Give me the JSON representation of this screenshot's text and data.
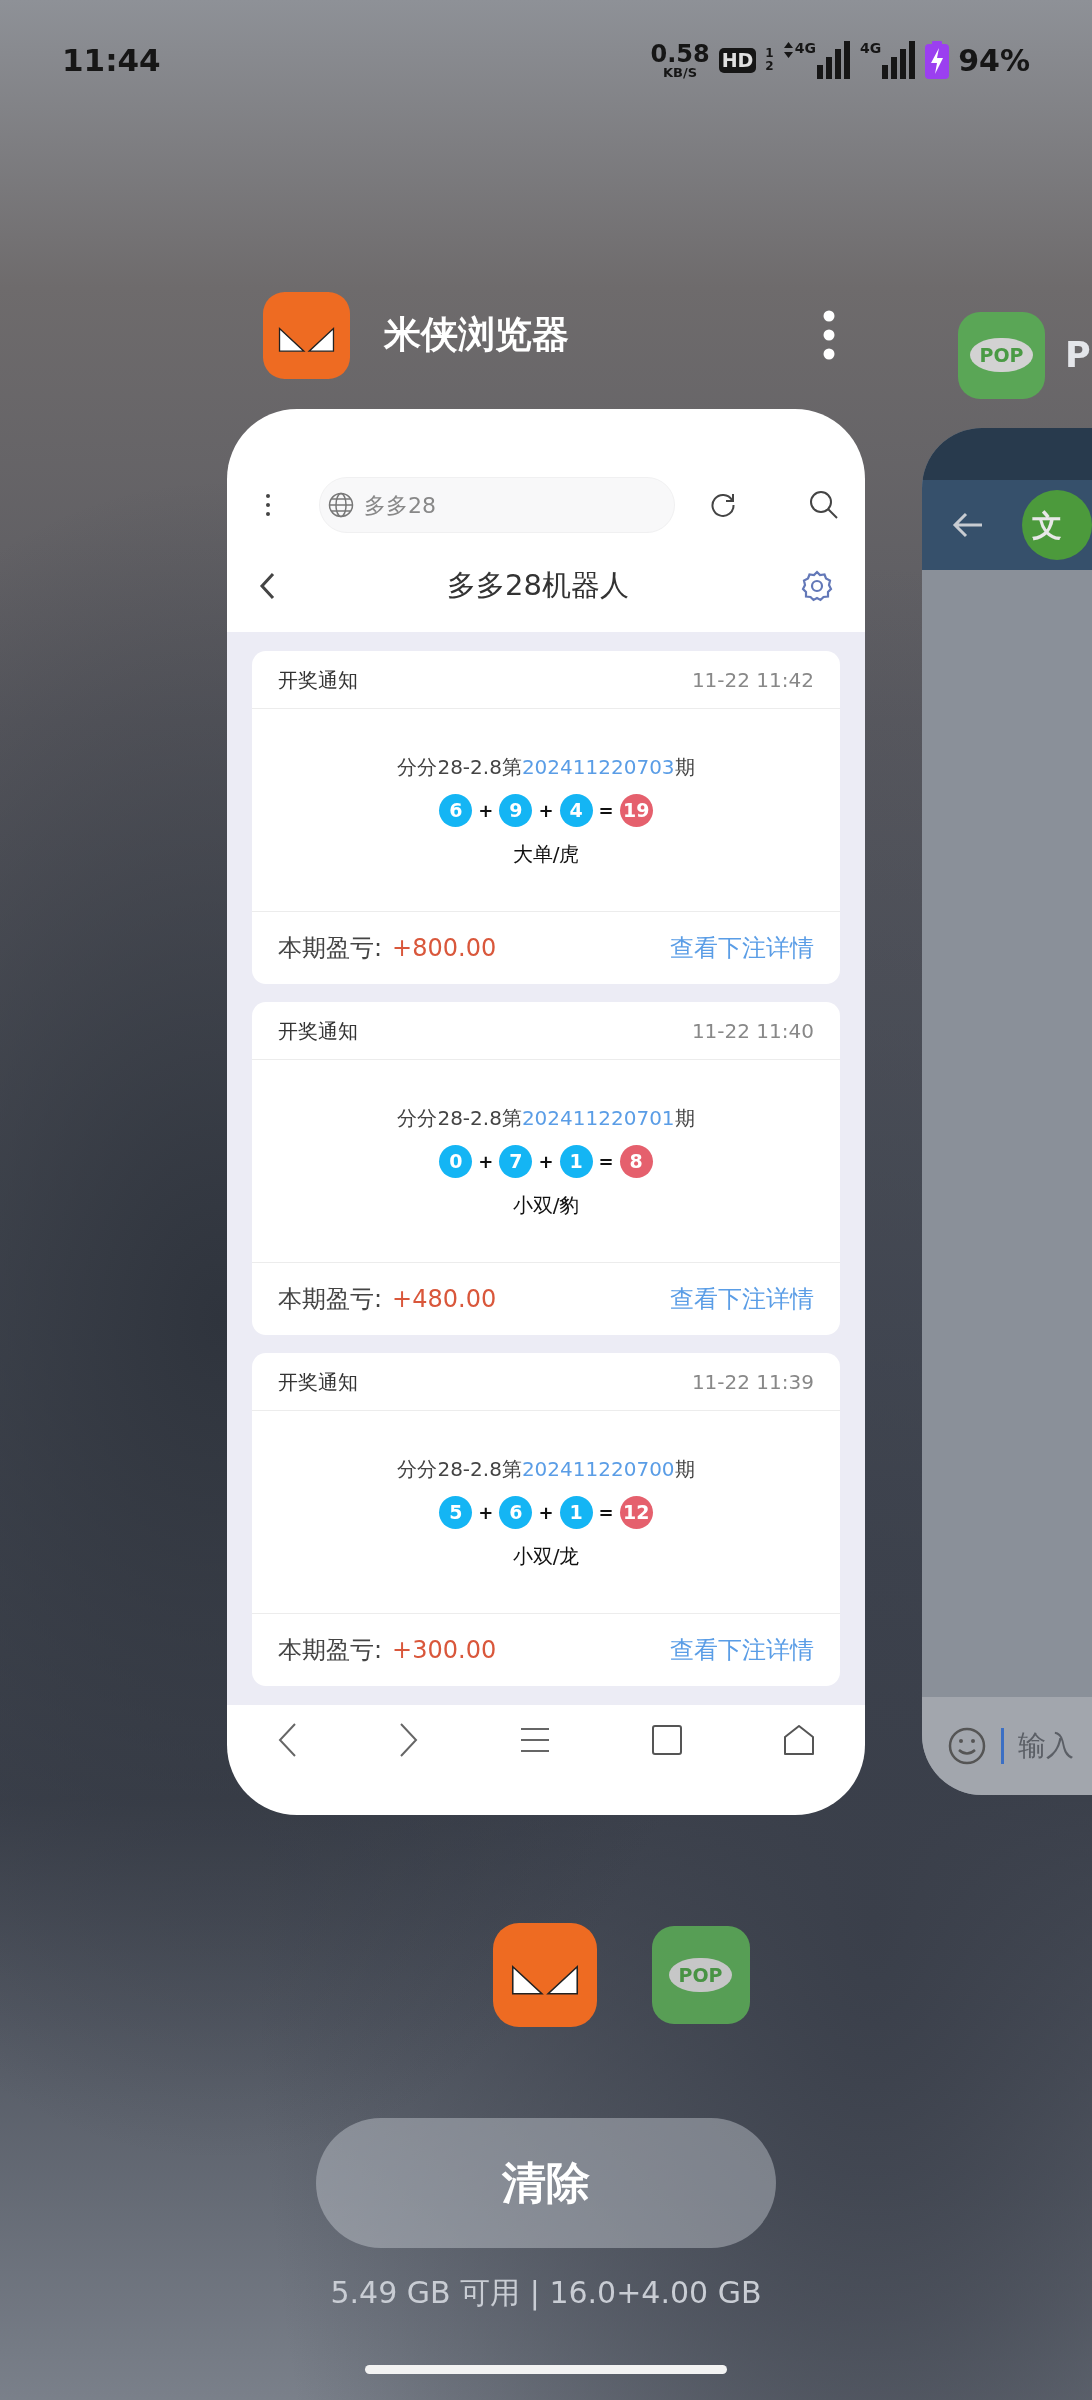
{
  "status_bar": {
    "time": "11:44",
    "speed": "0.58",
    "speed_unit": "KB/S",
    "hd": "HD",
    "hd_slots": [
      "1",
      "2"
    ],
    "signals": [
      {
        "label": "4G",
        "data_arrows": true
      },
      {
        "label": "4G",
        "data_arrows": false
      }
    ],
    "charging": true,
    "battery": "94%"
  },
  "recent_apps": [
    {
      "kind": "browser",
      "name": "米侠浏览器",
      "page": {
        "address": "多多28",
        "title": "多多28机器人",
        "notifications": [
          {
            "title": "开奖通知",
            "time": "11-22 11:42",
            "issue_prefix": "分分28-2.8第",
            "issue": "202411220703",
            "issue_suffix": "期",
            "balls": [
              "6",
              "9",
              "4"
            ],
            "operators": [
              "+",
              "+",
              "="
            ],
            "sum": "19",
            "result": "大单/虎",
            "profit_label": "本期盈亏:",
            "profit": "+800.00",
            "link": "查看下注详情"
          },
          {
            "title": "开奖通知",
            "time": "11-22 11:40",
            "issue_prefix": "分分28-2.8第",
            "issue": "202411220701",
            "issue_suffix": "期",
            "balls": [
              "0",
              "7",
              "1"
            ],
            "operators": [
              "+",
              "+",
              "="
            ],
            "sum": "8",
            "result": "小双/豹",
            "profit_label": "本期盈亏:",
            "profit": "+480.00",
            "link": "查看下注详情"
          },
          {
            "title": "开奖通知",
            "time": "11-22 11:39",
            "issue_prefix": "分分28-2.8第",
            "issue": "202411220700",
            "issue_suffix": "期",
            "balls": [
              "5",
              "6",
              "1"
            ],
            "operators": [
              "+",
              "+",
              "="
            ],
            "sum": "12",
            "result": "小双/龙",
            "profit_label": "本期盈亏:",
            "profit": "+300.00",
            "link": "查看下注详情"
          }
        ]
      }
    },
    {
      "kind": "chat",
      "name": "P",
      "logo_text": "POP",
      "chat": {
        "avatar": "文",
        "input_placeholder": "输入"
      }
    }
  ],
  "dock": [
    {
      "kind": "browser",
      "selected": true
    },
    {
      "kind": "chat",
      "logo_text": "POP",
      "selected": false
    }
  ],
  "clear_button": "清除",
  "memory": "5.49 GB 可用 | 16.0+4.00 GB"
}
